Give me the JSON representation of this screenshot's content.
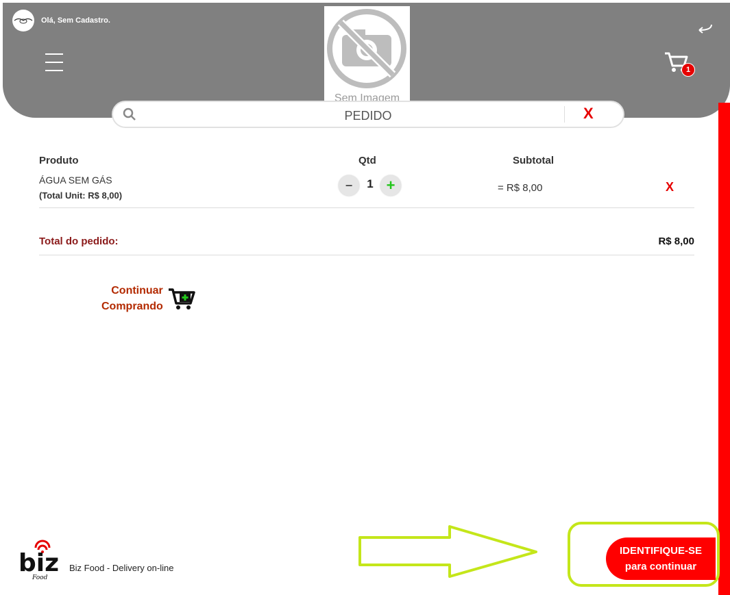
{
  "header": {
    "greeting": "Olá, Sem Cadastro.",
    "cart_count": "1",
    "product_image_label": "Sem Imagem"
  },
  "search": {
    "title": "PEDIDO",
    "close": "X"
  },
  "table": {
    "headers": {
      "product": "Produto",
      "qty": "Qtd",
      "subtotal": "Subtotal"
    },
    "items": [
      {
        "name": "ÁGUA SEM GÁS",
        "unit_total": "(Total Unit: R$ 8,00)",
        "qty_minus": "−",
        "qty": "1",
        "qty_plus": "+",
        "subtotal": "= R$ 8,00",
        "remove": "X"
      }
    ]
  },
  "summary": {
    "label": "Total do pedido:",
    "value": "R$ 8,00"
  },
  "continue": {
    "line1": "Continuar",
    "line2": "Comprando"
  },
  "footer": {
    "brand": "biz",
    "brand_sub": "Food",
    "tagline": "Biz Food - Delivery on-line"
  },
  "cta": {
    "line1": "IDENTIFIQUE-SE",
    "line2": "para continuar"
  },
  "colors": {
    "header_bg": "#808080",
    "accent_red": "#ff0000",
    "highlight": "#c4e61a",
    "dark_red": "#8b1a1a"
  },
  "icons": [
    "menu-icon",
    "back-arrow-icon",
    "cart-icon",
    "search-icon",
    "no-camera-icon",
    "cart-add-icon",
    "biz-logo-icon",
    "arrow-right-icon"
  ]
}
